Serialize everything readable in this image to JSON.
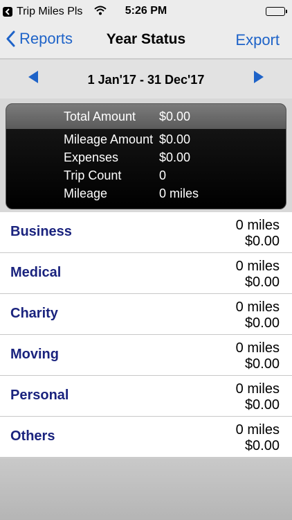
{
  "status_bar": {
    "app_name": "Trip Miles Pls",
    "time": "5:26 PM"
  },
  "nav": {
    "back_label": "Reports",
    "title": "Year Status",
    "export_label": "Export"
  },
  "date_range": {
    "label": "1 Jan'17 - 31 Dec'17"
  },
  "summary": {
    "rows": [
      {
        "label": "Total Amount",
        "value": "$0.00"
      },
      {
        "label": "Mileage Amount",
        "value": "$0.00"
      },
      {
        "label": "Expenses",
        "value": "$0.00"
      },
      {
        "label": "Trip Count",
        "value": "0"
      },
      {
        "label": "Mileage",
        "value": "0 miles"
      }
    ]
  },
  "categories": [
    {
      "name": "Business",
      "miles": "0 miles",
      "amount": "$0.00"
    },
    {
      "name": "Medical",
      "miles": "0 miles",
      "amount": "$0.00"
    },
    {
      "name": "Charity",
      "miles": "0 miles",
      "amount": "$0.00"
    },
    {
      "name": "Moving",
      "miles": "0 miles",
      "amount": "$0.00"
    },
    {
      "name": "Personal",
      "miles": "0 miles",
      "amount": "$0.00"
    },
    {
      "name": "Others",
      "miles": "0 miles",
      "amount": "$0.00"
    }
  ],
  "colors": {
    "accent": "#1e63c8",
    "category_text": "#1a237e"
  }
}
